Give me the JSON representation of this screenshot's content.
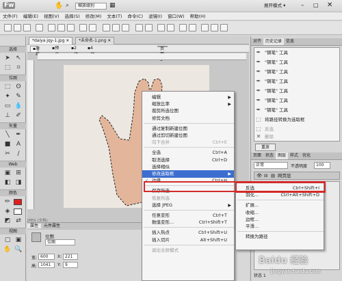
{
  "app": {
    "logo": "Fw",
    "zoom_label": "缩放级别",
    "workspace": "展开模式"
  },
  "menubar": [
    "文件(F)",
    "编辑(E)",
    "视图(V)",
    "选择(S)",
    "修改(M)",
    "文本(T)",
    "命令(C)",
    "滤镜(I)",
    "窗口(W)",
    "帮助(H)"
  ],
  "doc_tabs": [
    "*daiya jqy-1.jpg",
    "*未命名-1.png"
  ],
  "view_bar": {
    "original": "原始",
    "preview": "预览",
    "two_up": "2 幅",
    "four_up": "4 幅",
    "page": "页面 1"
  },
  "tools": {
    "select": "选择",
    "bitmap": "位图",
    "vector": "矢量",
    "web": "Web",
    "colors": "颜色",
    "view": "视图"
  },
  "canvas_label": "JPEG (文档)",
  "properties": {
    "tabs": [
      "属性",
      "元件属性"
    ],
    "type": "位图",
    "name": "位图",
    "w_label": "宽:",
    "w": "600",
    "x_label": "X:",
    "x": "221",
    "h_label": "高:",
    "h": "1041",
    "y_label": "Y:",
    "y": "9"
  },
  "right_panel": {
    "tabs": [
      "对齐",
      "历史记录",
      "信息"
    ],
    "history": [
      "\"钢笔\" 工具",
      "\"钢笔\" 工具",
      "\"钢笔\" 工具",
      "\"钢笔\" 工具",
      "\"钢笔\" 工具",
      "\"钢笔\" 工具",
      "\"钢笔\" 工具",
      "将路径转换为选取框",
      "反选",
      "删除"
    ],
    "replay_btn": "重放",
    "layer_tabs": [
      "页面",
      "状态",
      "图层",
      "样式",
      "优化"
    ],
    "blend": "正常",
    "opacity_label": "不透明度",
    "opacity": "100",
    "layer_name": "网页层",
    "bottom_item": "状态 1"
  },
  "context_menu": {
    "items": [
      {
        "label": "编辑",
        "submenu": true
      },
      {
        "label": "缩放比率",
        "submenu": true
      },
      {
        "label": "裁剪所选位图"
      },
      {
        "label": "修剪文档"
      },
      {
        "sep": true
      },
      {
        "label": "通过复制新建位图"
      },
      {
        "label": "通过剪切新建位图"
      },
      {
        "label": "向下合并",
        "shortcut": "Ctrl+E",
        "disabled": true
      },
      {
        "sep": true
      },
      {
        "label": "全选",
        "shortcut": "Ctrl+A"
      },
      {
        "label": "取消选择",
        "shortcut": "Ctrl+D"
      },
      {
        "label": "选择相似"
      },
      {
        "label": "修改选取框",
        "submenu": true,
        "highlighted": true
      },
      {
        "label": "边缘",
        "shortcut": "Ctrl+H",
        "checked": true
      },
      {
        "sep": true
      },
      {
        "label": "保存所选"
      },
      {
        "label": "恢复所选",
        "disabled": true
      },
      {
        "label": "选择 JPEG",
        "submenu": true
      },
      {
        "sep": true
      },
      {
        "label": "任意变形",
        "shortcut": "Ctrl+T"
      },
      {
        "label": "数值变形...",
        "shortcut": "Ctrl+Shift+T"
      },
      {
        "sep": true
      },
      {
        "label": "插入热点",
        "shortcut": "Ctrl+Shift+U"
      },
      {
        "label": "插入切片",
        "shortcut": "Alt+Shift+U"
      },
      {
        "sep": true
      },
      {
        "label": "退出全屏模式",
        "disabled": true
      }
    ]
  },
  "submenu": {
    "items": [
      {
        "label": "反选",
        "shortcut": "Ctrl+Shift+I"
      },
      {
        "label": "羽化...",
        "shortcut": "Ctrl+Alt+Shift+D"
      },
      {
        "sep": true
      },
      {
        "label": "扩展..."
      },
      {
        "label": "收缩..."
      },
      {
        "label": "边框..."
      },
      {
        "label": "平滑..."
      },
      {
        "sep": true
      },
      {
        "label": "转换为路径"
      }
    ]
  },
  "watermark": "Baidu 经验",
  "watermark_url": "jingyan.baidu.com",
  "colors": {
    "highlight": "#3d6ecf",
    "red_box": "#d42a2a"
  }
}
